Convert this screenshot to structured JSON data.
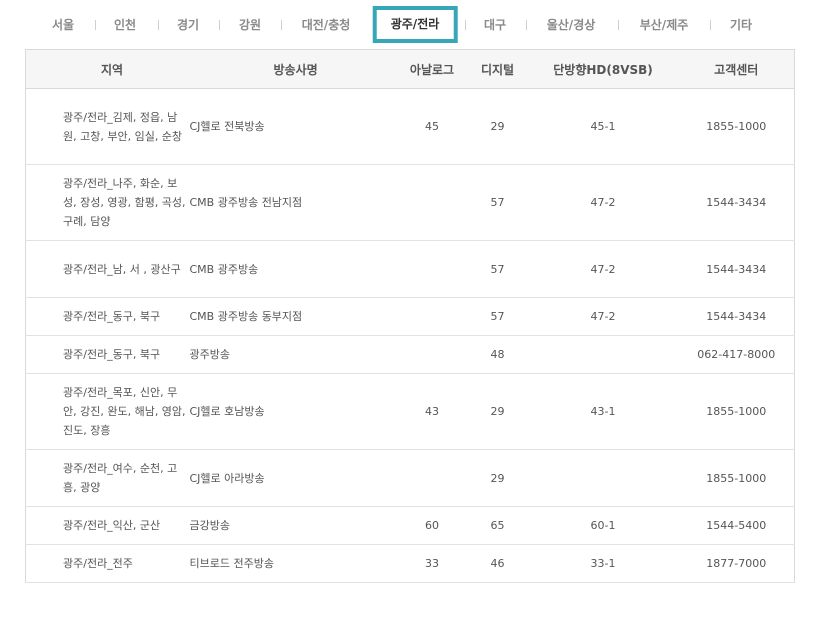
{
  "tabs": [
    {
      "label": "서울",
      "active": false
    },
    {
      "label": "인천",
      "active": false
    },
    {
      "label": "경기",
      "active": false
    },
    {
      "label": "강원",
      "active": false
    },
    {
      "label": "대전/충청",
      "active": false
    },
    {
      "label": "광주/전라",
      "active": true
    },
    {
      "label": "대구",
      "active": false
    },
    {
      "label": "울산/경상",
      "active": false
    },
    {
      "label": "부산/제주",
      "active": false
    },
    {
      "label": "기타",
      "active": false
    }
  ],
  "accent_color": "#37a7b8",
  "table": {
    "headers": [
      "지역",
      "방송사명",
      "아날로그",
      "디지털",
      "단방향HD(8VSB)",
      "고객센터"
    ],
    "rows": [
      {
        "region": "광주/전라_김제, 정읍, 남원, 고창, 부안, 임실, 순창",
        "company": "CJ헬로 전북방송",
        "analog": "45",
        "digital": "29",
        "hd": "45-1",
        "phone": "1855-1000"
      },
      {
        "region": "광주/전라_나주, 화순, 보성, 장성, 영광, 함평, 곡성, 구례, 담양",
        "company": "CMB 광주방송 전남지점",
        "analog": "",
        "digital": "57",
        "hd": "47-2",
        "phone": "1544-3434"
      },
      {
        "region": "광주/전라_남, 서 , 광산구",
        "company": "CMB 광주방송",
        "analog": "",
        "digital": "57",
        "hd": "47-2",
        "phone": "1544-3434"
      },
      {
        "region": "광주/전라_동구, 북구",
        "company": "CMB 광주방송 동부지점",
        "analog": "",
        "digital": "57",
        "hd": "47-2",
        "phone": "1544-3434"
      },
      {
        "region": "광주/전라_동구, 북구",
        "company": "광주방송",
        "analog": "",
        "digital": "48",
        "hd": "",
        "phone": "062-417-8000"
      },
      {
        "region": "광주/전라_목포, 신안, 무안, 강진, 완도, 해남, 영암, 진도, 장흥",
        "company": "CJ헬로 호남방송",
        "analog": "43",
        "digital": "29",
        "hd": "43-1",
        "phone": "1855-1000"
      },
      {
        "region": "광주/전라_여수, 순천, 고흥, 광양",
        "company": "CJ헬로 아라방송",
        "analog": "",
        "digital": "29",
        "hd": "",
        "phone": "1855-1000"
      },
      {
        "region": "광주/전라_익산, 군산",
        "company": "금강방송",
        "analog": "60",
        "digital": "65",
        "hd": "60-1",
        "phone": "1544-5400"
      },
      {
        "region": "광주/전라_전주",
        "company": "티브로드 전주방송",
        "analog": "33",
        "digital": "46",
        "hd": "33-1",
        "phone": "1877-7000"
      }
    ]
  }
}
